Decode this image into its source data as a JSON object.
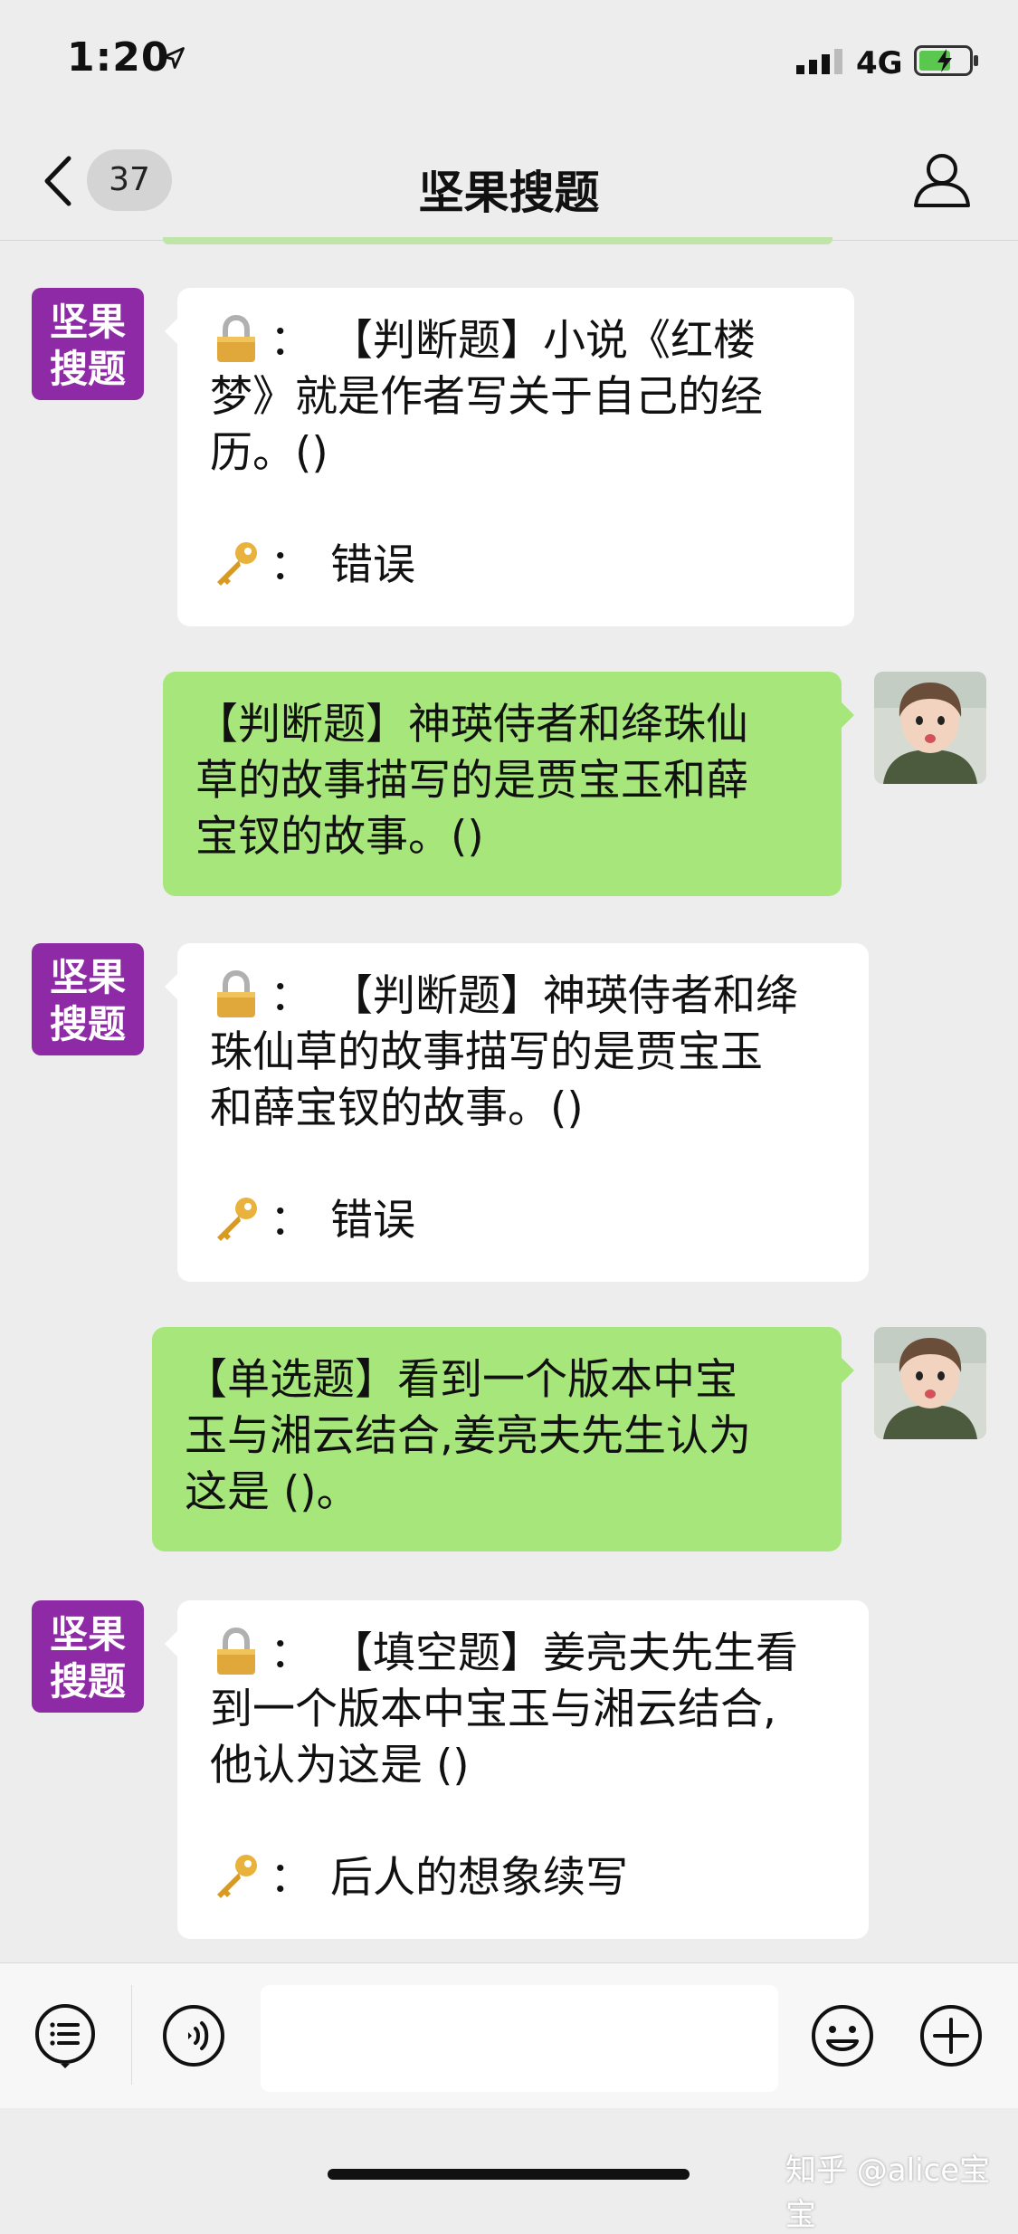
{
  "status_bar": {
    "time": "1:20",
    "network": "4G"
  },
  "nav": {
    "unread_count": "37",
    "title": "坚果搜题"
  },
  "bot": {
    "avatar_text_top": "坚果",
    "avatar_text_bottom": "搜题",
    "avatar_color": "#8e2aa6"
  },
  "messages": [
    {
      "side": "left",
      "question_prefix": "：",
      "question_lines": [
        "【判断题】小说《红楼",
        "梦》就是作者写关于自己的经",
        "历。()"
      ],
      "answer_prefix": "：",
      "answer": "错误"
    },
    {
      "side": "right",
      "lines": [
        "【判断题】神瑛侍者和绛珠仙",
        "草的故事描写的是贾宝玉和薛",
        "宝钗的故事。()"
      ]
    },
    {
      "side": "left",
      "question_prefix": "：",
      "question_lines": [
        "【判断题】神瑛侍者和绛",
        "珠仙草的故事描写的是贾宝玉",
        "和薛宝钗的故事。()"
      ],
      "answer_prefix": "：",
      "answer": "错误"
    },
    {
      "side": "right",
      "lines": [
        "【单选题】看到一个版本中宝",
        "玉与湘云结合,姜亮夫先生认为",
        "这是 ()。"
      ]
    },
    {
      "side": "left",
      "question_prefix": "：",
      "question_lines": [
        "【填空题】姜亮夫先生看",
        "到一个版本中宝玉与湘云结合,",
        "他认为这是 ()"
      ],
      "answer_prefix": "：",
      "answer": "后人的想象续写"
    }
  ],
  "input": {
    "value": ""
  },
  "watermark": "知乎 @alice宝宝",
  "colors": {
    "background": "#ededed",
    "sent_bubble": "#a7e67b",
    "received_bubble": "#ffffff"
  }
}
